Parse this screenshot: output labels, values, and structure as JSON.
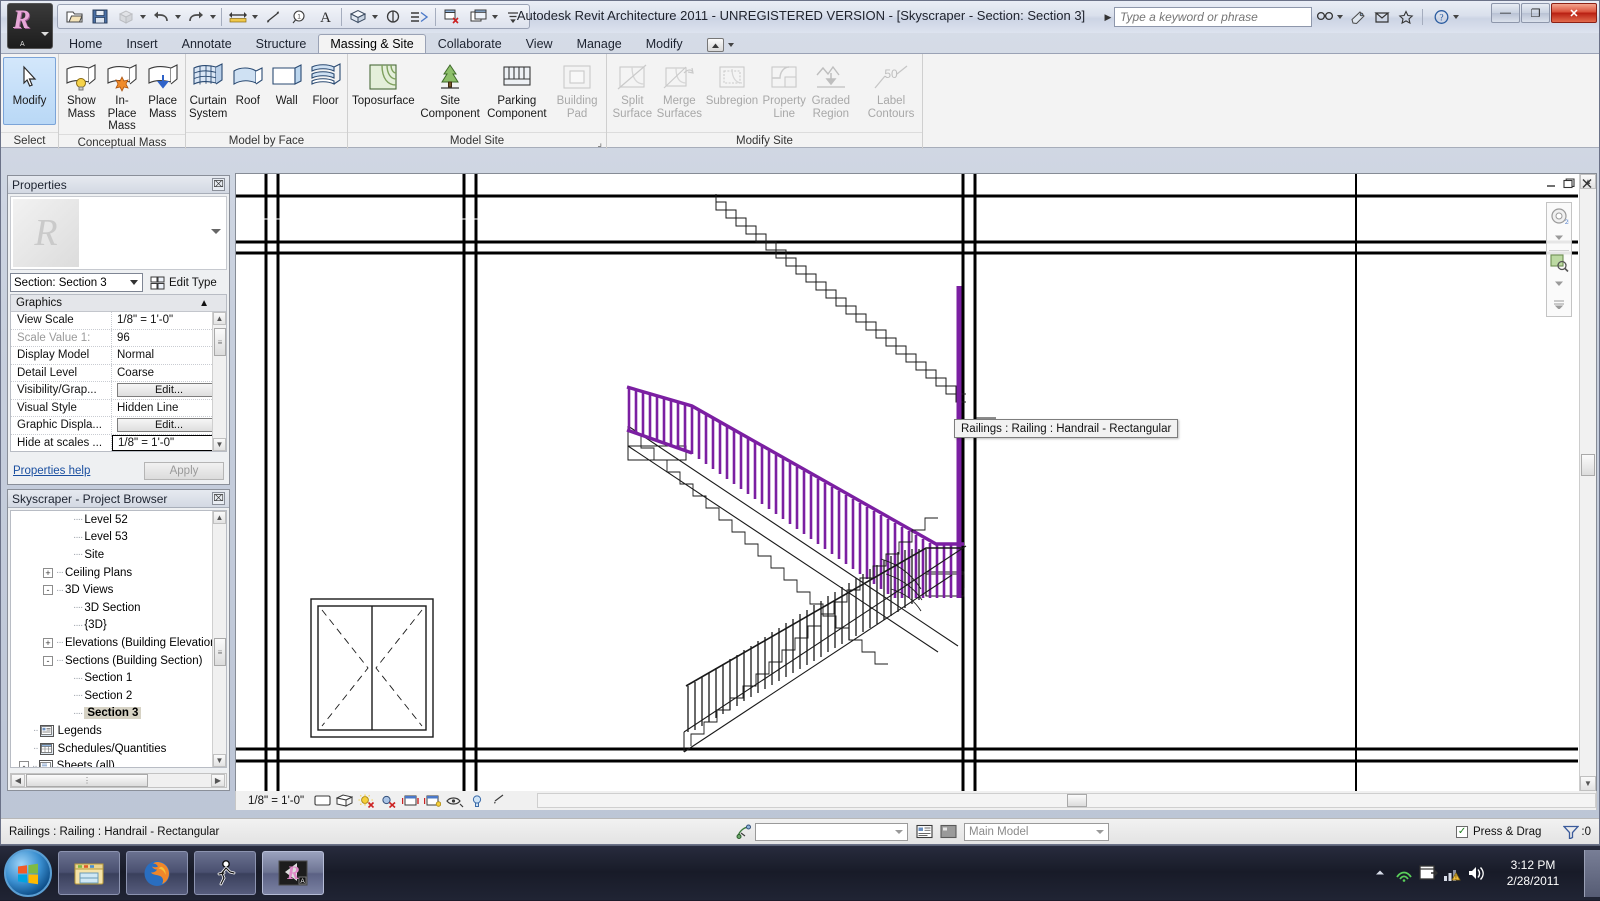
{
  "window": {
    "title": "Autodesk Revit Architecture 2011 - UNREGISTERED VERSION - [Skyscraper - Section: Section 3]",
    "minimize_label": "—",
    "maximize_label": "❐",
    "close_label": "✕"
  },
  "app_button": {
    "glyph": "R",
    "sub": "A"
  },
  "quick_access": [
    {
      "name": "open-icon",
      "label": "Open"
    },
    {
      "name": "save-icon",
      "label": "Save"
    },
    {
      "name": "export-icon",
      "label": "Export",
      "has_caret": true
    },
    {
      "name": "undo-icon",
      "label": "Undo",
      "has_caret": true
    },
    {
      "name": "redo-icon",
      "label": "Redo",
      "has_caret": true
    },
    {
      "name": "measure-icon",
      "label": "Measure",
      "has_caret": true
    },
    {
      "name": "aligned-dimension-icon",
      "label": "Aligned Dimension"
    },
    {
      "name": "tag-icon",
      "label": "Tag by Category"
    },
    {
      "name": "text-icon",
      "label": "Text"
    },
    {
      "name": "default-3d-view-icon",
      "label": "Default 3D View",
      "has_caret": true
    },
    {
      "name": "section-icon",
      "label": "Section"
    },
    {
      "name": "thin-lines-icon",
      "label": "Thin Lines"
    },
    {
      "name": "close-hidden-windows-icon",
      "label": "Close Hidden Windows"
    },
    {
      "name": "switch-windows-icon",
      "label": "Switch Windows",
      "has_caret": true
    },
    {
      "name": "customize-qat-icon",
      "label": "Customize Quick Access Toolbar"
    }
  ],
  "infocenter": {
    "placeholder": "Type a keyword or phrase",
    "value": "",
    "icons": [
      "search-icon",
      "subscription-center-icon",
      "communication-center-icon",
      "favorites-icon",
      "help-icon"
    ]
  },
  "ribbon": {
    "tabs": [
      {
        "label": "Home",
        "active": false
      },
      {
        "label": "Insert",
        "active": false
      },
      {
        "label": "Annotate",
        "active": false
      },
      {
        "label": "Structure",
        "active": false
      },
      {
        "label": "Massing & Site",
        "active": true
      },
      {
        "label": "Collaborate",
        "active": false
      },
      {
        "label": "View",
        "active": false
      },
      {
        "label": "Manage",
        "active": false
      },
      {
        "label": "Modify",
        "active": false
      }
    ],
    "panels": [
      {
        "title": "Select",
        "buttons": [
          {
            "label": "Modify",
            "icon": "arrow-cursor-icon",
            "selected": true,
            "disabled": false,
            "wide": false
          }
        ]
      },
      {
        "title": "Conceptual Mass",
        "buttons": [
          {
            "label": "Show\nMass",
            "line1": "Show",
            "line2": "Mass",
            "icon": "show-mass-icon",
            "selected": false,
            "disabled": false
          },
          {
            "label": "In-Place\nMass",
            "line1": "In-Place",
            "line2": "Mass",
            "icon": "in-place-mass-icon",
            "selected": false,
            "disabled": false
          },
          {
            "label": "Place\nMass",
            "line1": "Place",
            "line2": "Mass",
            "icon": "place-mass-icon",
            "selected": false,
            "disabled": false
          }
        ]
      },
      {
        "title": "Model by Face",
        "buttons": [
          {
            "line1": "Curtain",
            "line2": "System",
            "icon": "curtain-system-icon",
            "selected": false,
            "disabled": false
          },
          {
            "line1": "Roof",
            "line2": "",
            "icon": "roof-icon",
            "selected": false,
            "disabled": false
          },
          {
            "line1": "Wall",
            "line2": "",
            "icon": "wall-icon",
            "selected": false,
            "disabled": false
          },
          {
            "line1": "Floor",
            "line2": "",
            "icon": "floor-icon",
            "selected": false,
            "disabled": false
          }
        ]
      },
      {
        "title": "Model Site",
        "dialog_launcher": true,
        "buttons": [
          {
            "line1": "Toposurface",
            "line2": "",
            "icon": "toposurface-icon",
            "selected": false,
            "disabled": false,
            "wide": true
          },
          {
            "line1": "Site",
            "line2": "Component",
            "icon": "site-component-icon",
            "selected": false,
            "disabled": false,
            "wide": true
          },
          {
            "line1": "Parking",
            "line2": "Component",
            "icon": "parking-component-icon",
            "selected": false,
            "disabled": false,
            "wide": true
          },
          {
            "line1": "Building",
            "line2": "Pad",
            "icon": "building-pad-icon",
            "selected": false,
            "disabled": true,
            "wide": false
          }
        ]
      },
      {
        "title": "Modify Site",
        "buttons": [
          {
            "line1": "Split",
            "line2": "Surface",
            "icon": "split-surface-icon",
            "selected": false,
            "disabled": true
          },
          {
            "line1": "Merge",
            "line2": "Surfaces",
            "icon": "merge-surfaces-icon",
            "selected": false,
            "disabled": true
          },
          {
            "line1": "Subregion",
            "line2": "",
            "icon": "subregion-icon",
            "selected": false,
            "disabled": true,
            "wide": true
          },
          {
            "line1": "Property",
            "line2": "Line",
            "icon": "property-line-icon",
            "selected": false,
            "disabled": true
          },
          {
            "line1": "Graded",
            "line2": "Region",
            "icon": "graded-region-icon",
            "selected": false,
            "disabled": true
          },
          {
            "line1": "Label",
            "line2": "Contours",
            "icon": "label-contours-icon",
            "selected": false,
            "disabled": true,
            "wide": true
          }
        ]
      }
    ]
  },
  "properties": {
    "title": "Properties",
    "close_label": "⌧",
    "type_selector": "Section: Section 3",
    "edit_type_label": "Edit Type",
    "group_header": "Graphics",
    "rows": [
      {
        "key": "View Scale",
        "value": "1/8\" = 1'-0\"",
        "kind": "text",
        "dim": false
      },
      {
        "key": "Scale Value    1:",
        "value": "96",
        "kind": "text",
        "dim": true
      },
      {
        "key": "Display Model",
        "value": "Normal",
        "kind": "text",
        "dim": false
      },
      {
        "key": "Detail Level",
        "value": "Coarse",
        "kind": "text",
        "dim": false
      },
      {
        "key": "Visibility/Grap...",
        "value": "Edit...",
        "kind": "button",
        "dim": false
      },
      {
        "key": "Visual Style",
        "value": "Hidden Line",
        "kind": "text",
        "dim": false
      },
      {
        "key": "Graphic Displa...",
        "value": "Edit...",
        "kind": "button",
        "dim": false
      },
      {
        "key": "Hide at scales ...",
        "value": "1/8\" = 1'-0\"",
        "kind": "focus",
        "dim": false
      }
    ],
    "help_link": "Properties help",
    "apply_label": "Apply"
  },
  "browser": {
    "title": "Skyscraper - Project Browser",
    "close_label": "⌧",
    "nodes": [
      {
        "label": "Level 52",
        "indent": 3,
        "expander": "",
        "icon": false,
        "selected": false
      },
      {
        "label": "Level 53",
        "indent": 3,
        "expander": "",
        "icon": false,
        "selected": false
      },
      {
        "label": "Site",
        "indent": 3,
        "expander": "",
        "icon": false,
        "selected": false
      },
      {
        "label": "Ceiling Plans",
        "indent": 2,
        "expander": "+",
        "icon": false,
        "selected": false
      },
      {
        "label": "3D Views",
        "indent": 2,
        "expander": "-",
        "icon": false,
        "selected": false
      },
      {
        "label": "3D Section",
        "indent": 3,
        "expander": "",
        "icon": false,
        "selected": false
      },
      {
        "label": "{3D}",
        "indent": 3,
        "expander": "",
        "icon": false,
        "selected": false
      },
      {
        "label": "Elevations (Building Elevation",
        "indent": 2,
        "expander": "+",
        "icon": false,
        "selected": false
      },
      {
        "label": "Sections (Building Section)",
        "indent": 2,
        "expander": "-",
        "icon": false,
        "selected": false
      },
      {
        "label": "Section 1",
        "indent": 3,
        "expander": "",
        "icon": false,
        "selected": false
      },
      {
        "label": "Section 2",
        "indent": 3,
        "expander": "",
        "icon": false,
        "selected": false
      },
      {
        "label": "Section 3",
        "indent": 3,
        "expander": "",
        "icon": false,
        "selected": true
      },
      {
        "label": "Legends",
        "indent": 2,
        "expander": "",
        "icon": true,
        "icon_name": "legends-icon",
        "selected": false
      },
      {
        "label": "Schedules/Quantities",
        "indent": 2,
        "expander": "",
        "icon": true,
        "icon_name": "schedules-icon",
        "selected": false
      },
      {
        "label": "Sheets (all)",
        "indent": 1,
        "expander": "-",
        "icon": true,
        "icon_name": "sheets-icon",
        "selected": false
      }
    ]
  },
  "canvas": {
    "tooltip": "Railings : Railing : Handrail - Rectangular",
    "window_buttons": [
      "minimize-icon",
      "restore-icon",
      "close-icon"
    ],
    "navigation": [
      "steering-wheel-icon",
      "zoom-region-icon"
    ]
  },
  "viewbar": {
    "scale": "1/8\" = 1'-0\"",
    "icons": [
      "detail-level-coarse-icon",
      "visual-style-icon",
      "sun-path-off-icon",
      "shadows-off-icon",
      "show-render-dialog-icon",
      "crop-view-icon",
      "show-crop-region-icon",
      "temporary-hide-isolate-icon",
      "reveal-hidden-elements-icon",
      "analytical-model-icon"
    ]
  },
  "statusbar": {
    "message": "Railings : Railing : Handrail - Rectangular",
    "design_option_icon": "design-options-icon",
    "design_option_value": "",
    "worksets_icon": "worksets-icon",
    "exclude_options_icon": "exclude-options-icon",
    "model_value": "Main Model",
    "press_drag_label": "Press & Drag",
    "press_drag_checked": true,
    "filter_icon": "filter-icon",
    "filter_count": ":0"
  },
  "taskbar": {
    "start_label": "Start",
    "buttons": [
      {
        "name": "windows-explorer-taskbar-button",
        "icon": "folder-icon",
        "active": false
      },
      {
        "name": "firefox-taskbar-button",
        "icon": "firefox-icon",
        "active": false
      },
      {
        "name": "media-taskbar-button",
        "icon": "runner-icon",
        "active": false
      },
      {
        "name": "revit-taskbar-button",
        "icon": "revit-icon",
        "active": true
      }
    ],
    "tray": [
      "show-hidden-icons-arrow",
      "network-wireless-icon",
      "action-center-icon",
      "signal-icon",
      "volume-icon"
    ],
    "clock_time": "3:12 PM",
    "clock_date": "2/28/2011"
  },
  "colors": {
    "railing_highlight": "#7b1fa2",
    "accent_blue": "#b9d8f6",
    "window_bg": "#f3f3f3",
    "selection_tree": "#d6d2c4"
  }
}
